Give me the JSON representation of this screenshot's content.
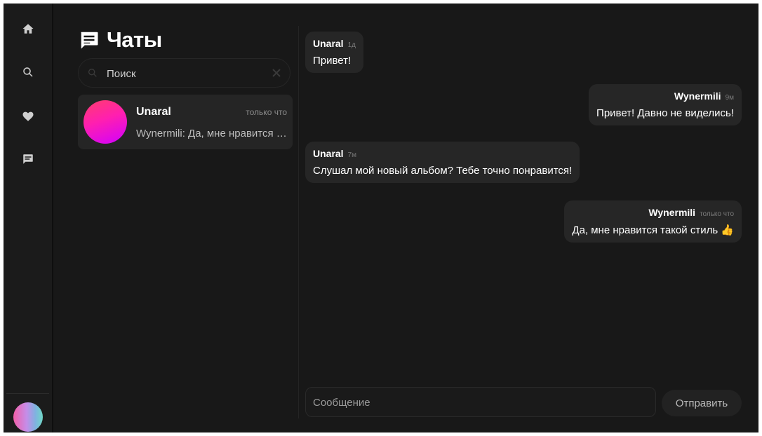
{
  "sidebar": {
    "icons": [
      "home-icon",
      "search-icon",
      "heart-icon",
      "chat-icon"
    ]
  },
  "chats_panel": {
    "title": "Чаты",
    "search": {
      "placeholder": "Поиск",
      "value": ""
    },
    "items": [
      {
        "name": "Unaral",
        "time": "только что",
        "preview": "Wynermili: Да, мне нравится такой стиль"
      }
    ]
  },
  "messages": [
    {
      "author": "Unaral",
      "ago": "1д",
      "text": "Привет!",
      "side": "left"
    },
    {
      "author": "Wynermili",
      "ago": "9м",
      "text": "Привет! Давно не виделись!",
      "side": "right"
    },
    {
      "author": "Unaral",
      "ago": "7м",
      "text": "Слушал мой новый альбом? Тебе точно понравится!",
      "side": "left"
    },
    {
      "author": "Wynermili",
      "ago": "только что",
      "text": "Да, мне нравится такой стиль",
      "emoji": "👍",
      "side": "right"
    }
  ],
  "composer": {
    "placeholder": "Сообщение",
    "value": "",
    "send_label": "Отправить"
  },
  "colors": {
    "background": "#181818",
    "bubble": "#262626",
    "chat_item": "#252525"
  }
}
